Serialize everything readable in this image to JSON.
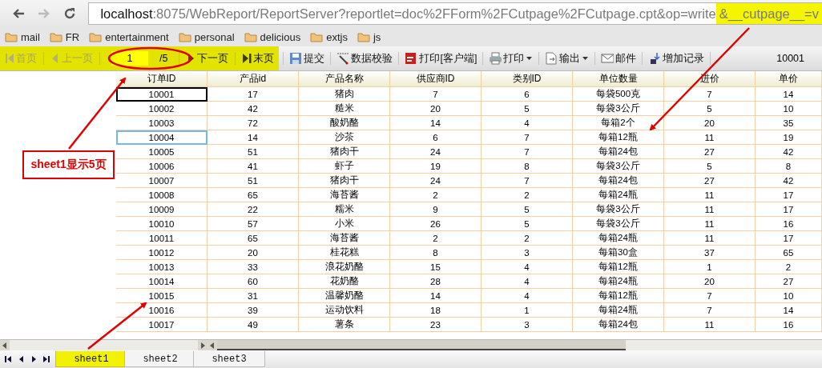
{
  "browser": {
    "url": {
      "host": "localhost",
      "path": ":8075/WebReport/ReportServer?reportlet=doc%2FForm%2FCutpage%2FCutpage.cpt&op=write",
      "highlight": "&__cutpage__=v"
    },
    "bookmarks": [
      "mail",
      "FR",
      "entertainment",
      "personal",
      "delicious",
      "extjs",
      "js"
    ]
  },
  "toolbar": {
    "nav": [
      {
        "kind": "first",
        "label": "首页",
        "disabled": true
      },
      {
        "kind": "prev",
        "label": "上一页",
        "disabled": true
      },
      {
        "kind": "page",
        "value": "1",
        "total": "/5"
      },
      {
        "kind": "next",
        "label": "下一页",
        "disabled": false
      },
      {
        "kind": "last",
        "label": "末页",
        "disabled": false
      }
    ],
    "buttons": [
      {
        "kind": "save",
        "label": "提交",
        "dropdown": false
      },
      {
        "kind": "check",
        "label": "数据校验",
        "dropdown": false
      },
      {
        "kind": "pdf",
        "label": "打印[客户端]",
        "dropdown": false
      },
      {
        "kind": "print",
        "label": "打印",
        "dropdown": true
      },
      {
        "kind": "export",
        "label": "输出",
        "dropdown": true
      },
      {
        "kind": "mail",
        "label": "邮件",
        "dropdown": false
      },
      {
        "kind": "add",
        "label": "增加记录",
        "dropdown": false
      }
    ],
    "cell_value": "10001"
  },
  "table": {
    "columns": [
      "订单ID",
      "产品id",
      "产品名称",
      "供应商ID",
      "类别ID",
      "单位数量",
      "进价",
      "单价"
    ],
    "rows": [
      {
        "cells": [
          "10001",
          "17",
          "猪肉",
          "7",
          "6",
          "每袋500克",
          "7",
          "14"
        ],
        "selected": true,
        "hovered": false
      },
      {
        "cells": [
          "10002",
          "42",
          "糙米",
          "20",
          "5",
          "每袋3公斤",
          "5",
          "10"
        ],
        "selected": false,
        "hovered": false
      },
      {
        "cells": [
          "10003",
          "72",
          "酸奶酪",
          "14",
          "4",
          "每箱2个",
          "20",
          "35"
        ],
        "selected": false,
        "hovered": false
      },
      {
        "cells": [
          "10004",
          "14",
          "沙茶",
          "6",
          "7",
          "每箱12瓶",
          "11",
          "19"
        ],
        "selected": false,
        "hovered": true
      },
      {
        "cells": [
          "10005",
          "51",
          "猪肉干",
          "24",
          "7",
          "每箱24包",
          "27",
          "42"
        ],
        "selected": false,
        "hovered": false
      },
      {
        "cells": [
          "10006",
          "41",
          "虾子",
          "19",
          "8",
          "每袋3公斤",
          "5",
          "8"
        ],
        "selected": false,
        "hovered": false
      },
      {
        "cells": [
          "10007",
          "51",
          "猪肉干",
          "24",
          "7",
          "每箱24包",
          "27",
          "42"
        ],
        "selected": false,
        "hovered": false
      },
      {
        "cells": [
          "10008",
          "65",
          "海苔酱",
          "2",
          "2",
          "每箱24瓶",
          "11",
          "17"
        ],
        "selected": false,
        "hovered": false
      },
      {
        "cells": [
          "10009",
          "22",
          "糯米",
          "9",
          "5",
          "每袋3公斤",
          "11",
          "17"
        ],
        "selected": false,
        "hovered": false
      },
      {
        "cells": [
          "10010",
          "57",
          "小米",
          "26",
          "5",
          "每袋3公斤",
          "11",
          "16"
        ],
        "selected": false,
        "hovered": false
      },
      {
        "cells": [
          "10011",
          "65",
          "海苔酱",
          "2",
          "2",
          "每箱24瓶",
          "11",
          "17"
        ],
        "selected": false,
        "hovered": false
      },
      {
        "cells": [
          "10012",
          "20",
          "桂花糕",
          "8",
          "3",
          "每箱30盒",
          "37",
          "65"
        ],
        "selected": false,
        "hovered": false
      },
      {
        "cells": [
          "10013",
          "33",
          "浪花奶酪",
          "15",
          "4",
          "每箱12瓶",
          "1",
          "2"
        ],
        "selected": false,
        "hovered": false
      },
      {
        "cells": [
          "10014",
          "60",
          "花奶酪",
          "28",
          "4",
          "每箱24瓶",
          "20",
          "27"
        ],
        "selected": false,
        "hovered": false
      },
      {
        "cells": [
          "10015",
          "31",
          "温馨奶酪",
          "14",
          "4",
          "每箱12瓶",
          "7",
          "10"
        ],
        "selected": false,
        "hovered": false
      },
      {
        "cells": [
          "10016",
          "39",
          "运动饮料",
          "18",
          "1",
          "每箱24瓶",
          "7",
          "14"
        ],
        "selected": false,
        "hovered": false
      },
      {
        "cells": [
          "10017",
          "49",
          "薯条",
          "23",
          "3",
          "每箱24包",
          "11",
          "16"
        ],
        "selected": false,
        "hovered": false
      }
    ]
  },
  "sheet_tabs": [
    {
      "label": "sheet1",
      "selected": true
    },
    {
      "label": "sheet2",
      "selected": false
    },
    {
      "label": "sheet3",
      "selected": false
    }
  ],
  "annotation": {
    "text": "sheet1显示5页"
  }
}
